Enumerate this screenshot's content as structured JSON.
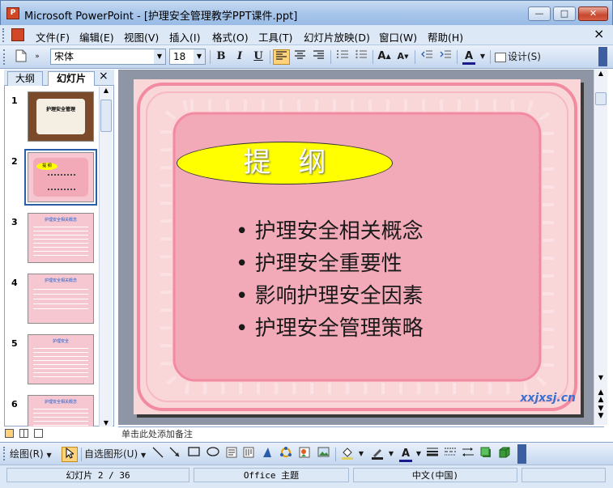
{
  "window": {
    "app_icon": "P",
    "title": "Microsoft PowerPoint - [护理安全管理教学PPT课件.ppt]",
    "minimize_glyph": "—",
    "maximize_glyph": "□",
    "close_glyph": "✕"
  },
  "menu": {
    "items": [
      "文件(F)",
      "编辑(E)",
      "视图(V)",
      "插入(I)",
      "格式(O)",
      "工具(T)",
      "幻灯片放映(D)",
      "窗口(W)",
      "帮助(H)"
    ],
    "close_doc": "×"
  },
  "toolbar": {
    "font_name": "宋体",
    "font_size": "18",
    "bold": "B",
    "italic": "I",
    "underline": "U",
    "design_label": "设计(S)"
  },
  "outline_pane": {
    "tabs": [
      "大纲",
      "幻灯片"
    ],
    "active_tab": "幻灯片",
    "close": "×",
    "thumbnails": [
      {
        "num": "1",
        "title": "护理安全管理"
      },
      {
        "num": "2",
        "title": "提 纲"
      },
      {
        "num": "3",
        "title": "护理安全相关概念"
      },
      {
        "num": "4",
        "title": "护理安全相关概念"
      },
      {
        "num": "5",
        "title": "护理安全"
      },
      {
        "num": "6",
        "title": "护理安全相关概念"
      }
    ],
    "selected": "2"
  },
  "slide": {
    "title": "提　纲",
    "bullets": [
      "护理安全相关概念",
      "护理安全重要性",
      "影响护理安全因素",
      "护理安全管理策略"
    ],
    "watermark": "xxjxsj.cn",
    "colors": {
      "outer": "#f9d7d8",
      "inner": "#f3aab8",
      "stripe": "#f28ba1",
      "ellipse": "#ffff00"
    }
  },
  "notes": {
    "placeholder": "单击此处添加备注"
  },
  "drawing_toolbar": {
    "draw_label": "绘图(R)",
    "autoshape_label": "自选图形(U)"
  },
  "status": {
    "slide_pos": "幻灯片 2 / 36",
    "theme": "Office 主题",
    "language": "中文(中国)"
  }
}
